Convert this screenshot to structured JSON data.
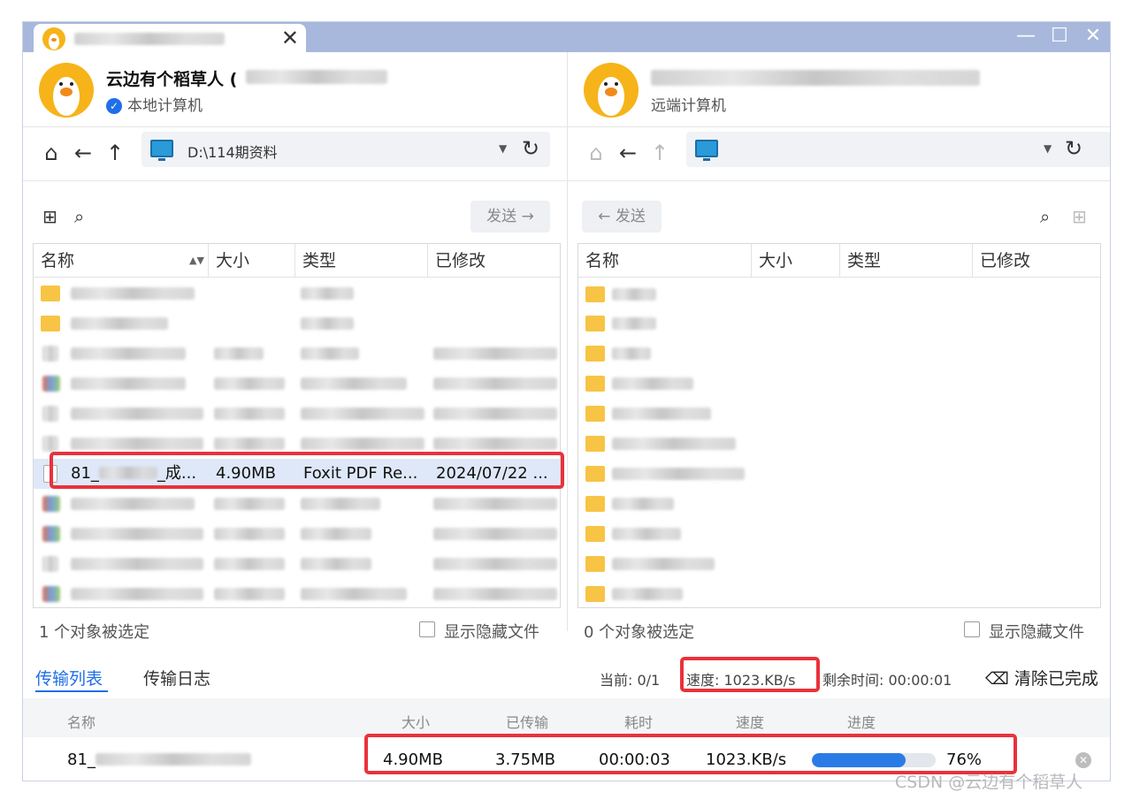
{
  "window": {
    "tab_close": "✕",
    "controls": {
      "minimize": "—",
      "maximize": "☐",
      "close": "✕"
    }
  },
  "left": {
    "user_name": "云边有个稻草人 (",
    "user_sub": "本地计算机",
    "path": "D:\\114期资料",
    "send_label": "发送 →",
    "columns": [
      "名称",
      "大小",
      "类型",
      "已修改"
    ],
    "selected_row": {
      "name": "81_",
      "name_suffix": "_成...",
      "size": "4.90MB",
      "type": "Foxit PDF Re...",
      "modified": "2024/07/22 ..."
    },
    "status": "1 个对象被选定",
    "show_hidden": "显示隐藏文件"
  },
  "right": {
    "user_sub": "远端计算机",
    "send_label": "← 发送",
    "columns": [
      "名称",
      "大小",
      "类型",
      "已修改"
    ],
    "status": "0 个对象被选定",
    "show_hidden": "显示隐藏文件"
  },
  "transfer": {
    "tabs": [
      "传输列表",
      "传输日志"
    ],
    "current": "当前: 0/1",
    "speed": "速度: 1023.KB/s",
    "remaining": "剩余时间: 00:00:01",
    "clear": "清除已完成",
    "columns": [
      "名称",
      "大小",
      "已传输",
      "耗时",
      "速度",
      "进度"
    ],
    "row": {
      "name": "81_",
      "size": "4.90MB",
      "transferred": "3.75MB",
      "elapsed": "00:00:03",
      "speed": "1023.KB/s",
      "progress_label": "76%",
      "progress": 0.76
    }
  },
  "watermark": "CSDN @云边有个稻草人",
  "colors": {
    "accent": "#1f6fe8",
    "titlebar": "#a8b8dc",
    "highlight": "#e8323c",
    "progress": "#2b7be6"
  }
}
